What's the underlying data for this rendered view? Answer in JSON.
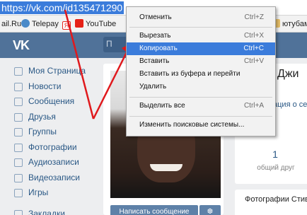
{
  "browser": {
    "url": "https://vk.com/id135471290",
    "bookmarks": [
      {
        "label": "ail.Ru",
        "icon": "mail-icon",
        "color": "#168de2"
      },
      {
        "label": "Telepay",
        "icon": "telepay-icon",
        "color": "#4a8ac9"
      },
      {
        "label": "Я",
        "icon": "yandex-icon",
        "color": "#e52620"
      },
      {
        "label": "YouTube",
        "icon": "youtube-icon",
        "color": "#e62117"
      },
      {
        "label": "ютубам",
        "icon": "folder-icon",
        "color": "#e8c16a"
      }
    ]
  },
  "vk": {
    "logo": "VK",
    "search_placeholder": "П",
    "nav": [
      {
        "label": "Моя Страница",
        "icon": "home-icon"
      },
      {
        "label": "Новости",
        "icon": "news-icon"
      },
      {
        "label": "Сообщения",
        "icon": "messages-icon"
      },
      {
        "label": "Друзья",
        "icon": "friends-icon"
      },
      {
        "label": "Группы",
        "icon": "groups-icon"
      },
      {
        "label": "Фотографии",
        "icon": "photos-icon"
      },
      {
        "label": "Аудиозаписи",
        "icon": "audio-icon"
      },
      {
        "label": "Видеозаписи",
        "icon": "video-icon"
      },
      {
        "label": "Игры",
        "icon": "games-icon"
      },
      {
        "label": "Закладки",
        "icon": "bookmarks-icon"
      }
    ],
    "profile": {
      "name": "Джи",
      "status": "ация о себе",
      "friends_count": "1",
      "friends_label": "общий друг",
      "photos_label": "Фотографии Стиви",
      "write_button": "Написать сообщение",
      "gift_icon": "gift-icon"
    }
  },
  "context_menu": {
    "items": [
      {
        "label": "Отменить",
        "shortcut": "Ctrl+Z"
      },
      {
        "label": "Вырезать",
        "shortcut": "Ctrl+X"
      },
      {
        "label": "Копировать",
        "shortcut": "Ctrl+C",
        "highlighted": true
      },
      {
        "label": "Вставить",
        "shortcut": "Ctrl+V"
      },
      {
        "label": "Вставить из буфера и перейти",
        "shortcut": ""
      },
      {
        "label": "Удалить",
        "shortcut": ""
      },
      {
        "label": "Выделить все",
        "shortcut": "Ctrl+A"
      },
      {
        "label": "Изменить поисковые системы...",
        "shortcut": ""
      }
    ]
  },
  "colors": {
    "vk_header": "#507299",
    "selection": "#3b7cdb",
    "annotation_arrow": "#e0191d"
  }
}
